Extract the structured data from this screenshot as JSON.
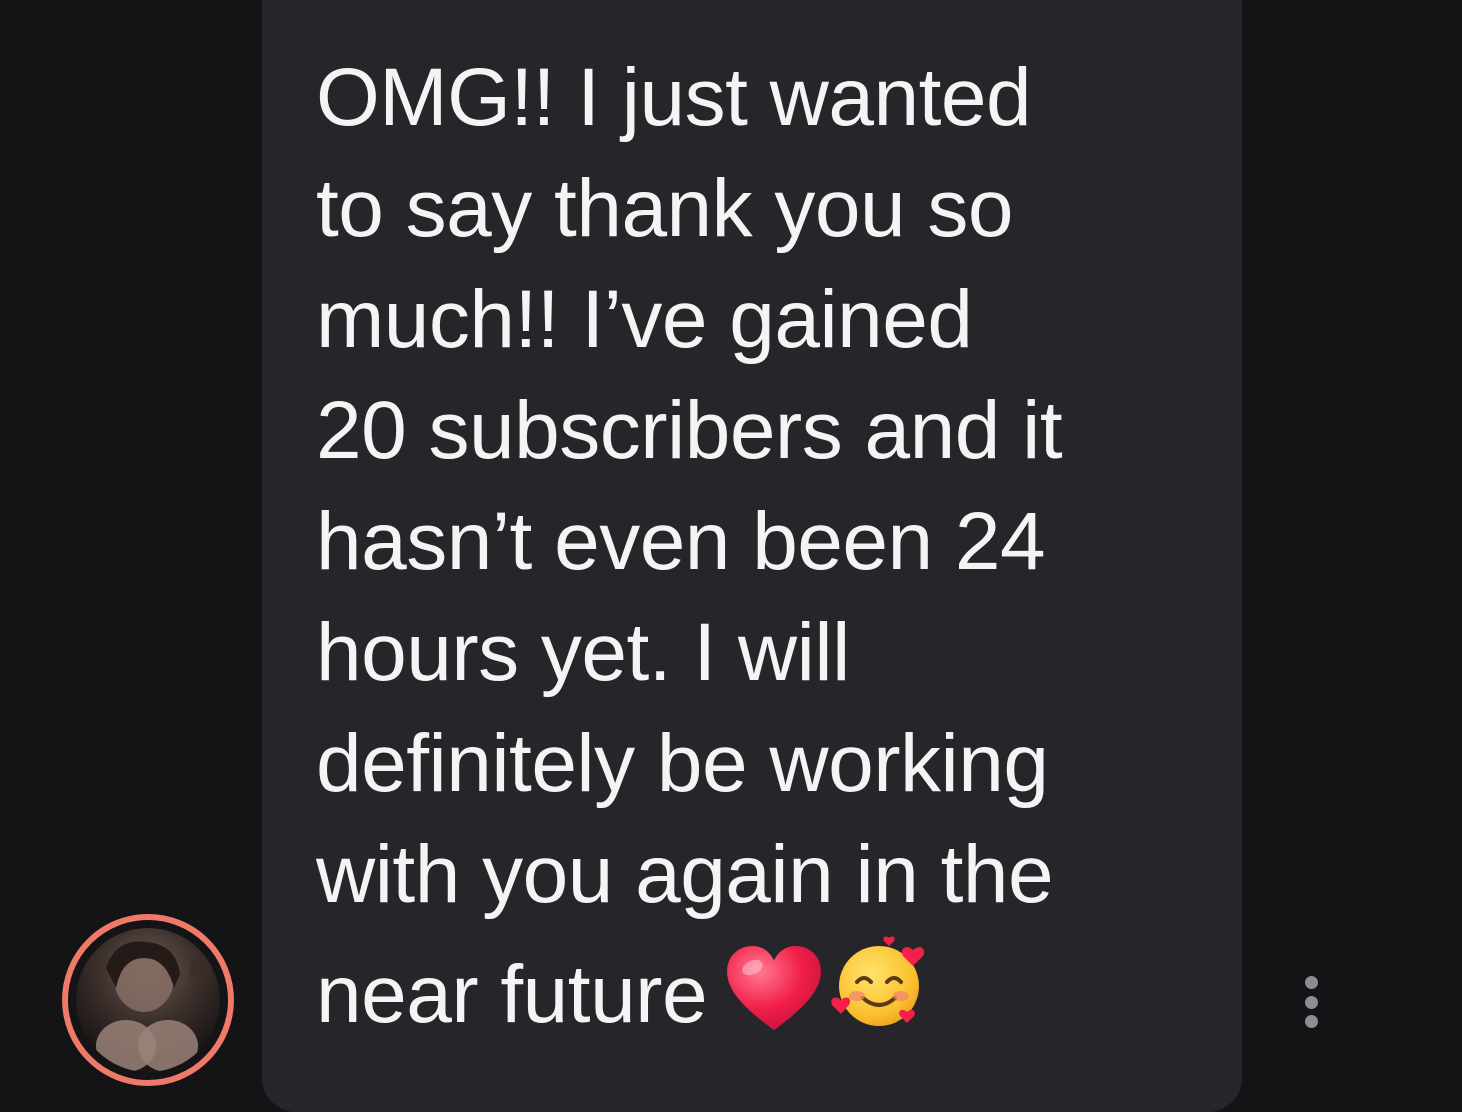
{
  "message": {
    "lines": [
      "OMG!! I just wanted",
      "to say thank you so",
      "much!! I’ve gained",
      "20 subscribers and it",
      "hasn’t even been 24",
      "hours yet. I will",
      "definitely be working",
      "with you again in the",
      "near future"
    ],
    "emojis": [
      "red-heart-emoji",
      "smiling-face-with-hearts-emoji"
    ]
  },
  "avatar": {
    "ring_color": "#f07a68"
  },
  "more_options": {
    "icon": "more-vertical-icon"
  },
  "colors": {
    "background": "#141417",
    "bubble": "#26262a",
    "text": "#f4f4f4"
  }
}
